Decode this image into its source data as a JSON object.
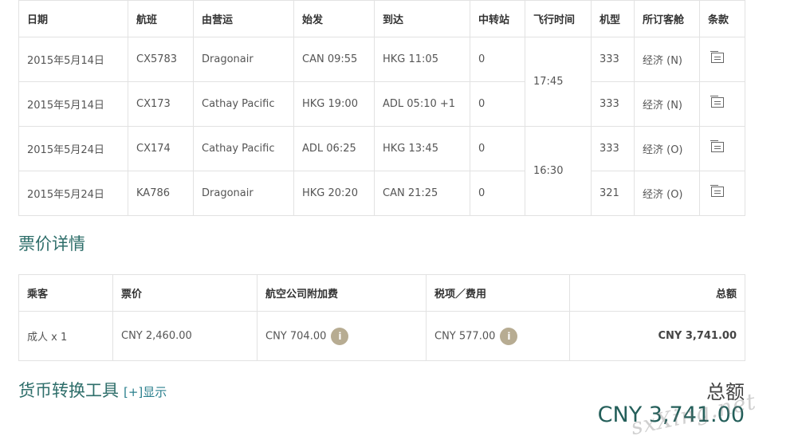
{
  "flight_table": {
    "headers": [
      "日期",
      "航班",
      "由营运",
      "始发",
      "到达",
      "中转站",
      "飞行时间",
      "机型",
      "所订客舱",
      "条款"
    ],
    "rows": [
      {
        "date": "2015年5月14日",
        "flight": "CX5783",
        "operator": "Dragonair",
        "depart": "CAN 09:55",
        "arrive": "HKG 11:05",
        "stops": "0",
        "aircraft": "333",
        "cabin": "经济 (N)",
        "terms_icon": "document-icon"
      },
      {
        "date": "2015年5月14日",
        "flight": "CX173",
        "operator": "Cathay Pacific",
        "depart": "HKG 19:00",
        "arrive": "ADL 05:10 +1",
        "stops": "0",
        "aircraft": "333",
        "cabin": "经济 (N)",
        "terms_icon": "document-icon"
      },
      {
        "date": "2015年5月24日",
        "flight": "CX174",
        "operator": "Cathay Pacific",
        "depart": "ADL 06:25",
        "arrive": "HKG 13:45",
        "stops": "0",
        "aircraft": "333",
        "cabin": "经济 (O)",
        "terms_icon": "document-icon"
      },
      {
        "date": "2015年5月24日",
        "flight": "KA786",
        "operator": "Dragonair",
        "depart": "HKG 20:20",
        "arrive": "CAN 21:25",
        "stops": "0",
        "aircraft": "321",
        "cabin": "经济 (O)",
        "terms_icon": "document-icon"
      }
    ],
    "durations": [
      "17:45",
      "16:30"
    ]
  },
  "fare_section": {
    "title": "票价详情",
    "headers": {
      "passenger": "乘客",
      "fare": "票价",
      "surcharge": "航空公司附加费",
      "tax": "税项／费用",
      "total": "总额"
    },
    "row": {
      "passenger": "成人 x 1",
      "fare": "CNY 2,460.00",
      "surcharge": "CNY 704.00",
      "tax": "CNY 577.00",
      "total": "CNY 3,741.00"
    },
    "info_icon_label": "i"
  },
  "currency_tool": {
    "title": "货币转换工具",
    "toggle": "[+]显示"
  },
  "grand_total": {
    "label": "总额",
    "value": "CNY 3,741.00"
  },
  "watermark": "sxXing.net",
  "colors": {
    "accent": "#2a7f8d",
    "heading": "#2e6e6a",
    "info_badge": "#b7ac92",
    "total": "#245f5a"
  }
}
